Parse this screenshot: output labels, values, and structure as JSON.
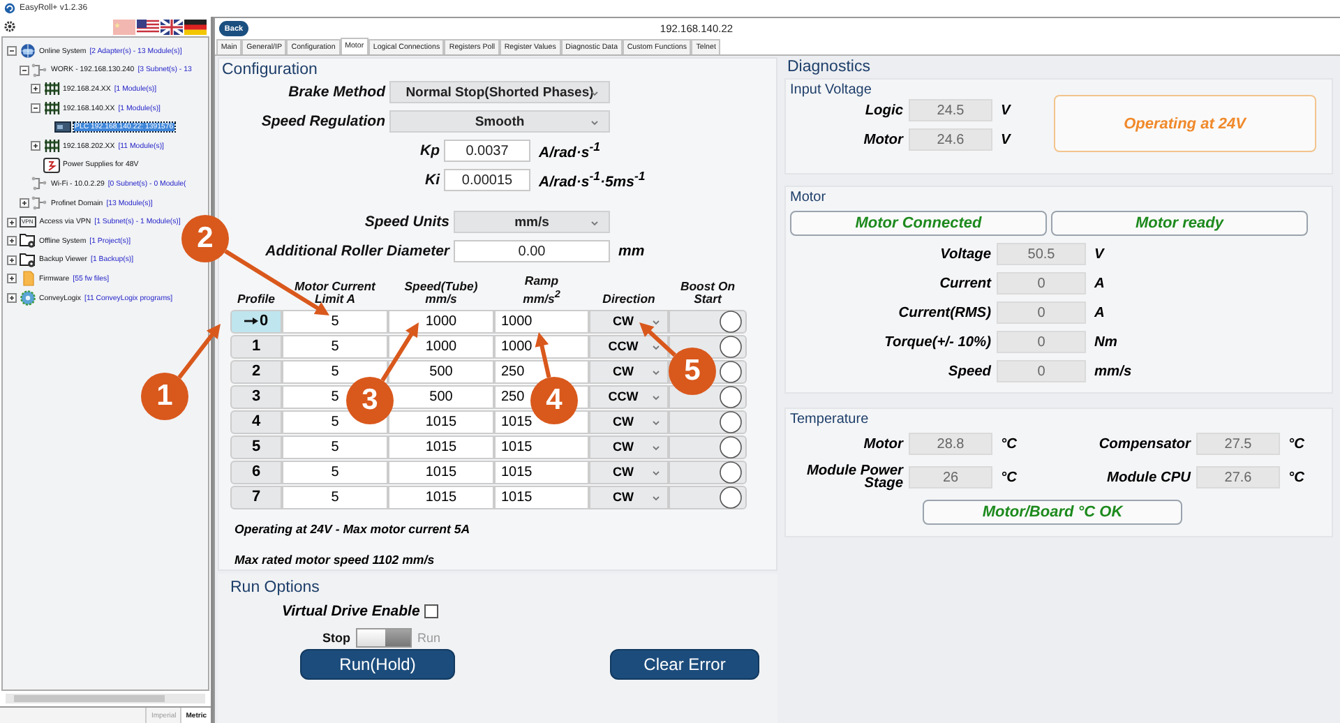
{
  "window": {
    "title": "EasyRoll+ v1.2.36"
  },
  "sidebar": {
    "tree": [
      {
        "kind": "globe",
        "label": "Online System",
        "detail": "[2 Adapter(s) - 13 Module(s)]",
        "expanded": true,
        "selected": false,
        "children": [
          {
            "kind": "network",
            "label": "WORK - 192.168.130.240",
            "detail": "[3 Subnet(s) - 13",
            "expanded": true,
            "selected": false,
            "children": [
              {
                "kind": "switch",
                "label": "192.168.24.XX",
                "detail": "[1 Module(s)]",
                "expanded": false,
                "selected": false
              },
              {
                "kind": "switch",
                "label": "192.168.140.XX",
                "detail": "[1 Module(s)]",
                "expanded": true,
                "selected": false,
                "children": [
                  {
                    "kind": "plc",
                    "label": "PLC 192.168.140.22: 1391576",
                    "selected": true
                  }
                ]
              },
              {
                "kind": "switch",
                "label": "192.168.202.XX",
                "detail": "[11 Module(s)]",
                "expanded": false,
                "selected": false
              },
              {
                "kind": "power",
                "label": "Power Supplies for 48V",
                "selected": false
              }
            ]
          },
          {
            "kind": "network",
            "label": "Wi-Fi - 10.0.2.29",
            "detail": "[0 Subnet(s) - 0 Module(",
            "selected": false
          },
          {
            "kind": "network",
            "label": "Profinet Domain",
            "detail": "[13 Module(s)]",
            "expanded": false,
            "selected": false
          }
        ]
      },
      {
        "kind": "vpn",
        "icon_label": "VPN",
        "label": "Access via VPN",
        "detail": "[1 Subnet(s) - 1 Module(s)]",
        "expanded": false,
        "selected": false
      },
      {
        "kind": "folder",
        "label": "Offline System",
        "detail": "[1 Project(s)]",
        "expanded": false,
        "selected": false
      },
      {
        "kind": "folder",
        "label": "Backup Viewer",
        "detail": "[1 Backup(s)]",
        "expanded": false,
        "selected": false
      },
      {
        "kind": "firmware",
        "label": "Firmware",
        "detail": "[55 fw files]",
        "expanded": false,
        "selected": false
      },
      {
        "kind": "logix",
        "label": "ConveyLogix",
        "detail": "[11 ConveyLogix programs]",
        "expanded": false,
        "selected": false
      }
    ],
    "unit_tabs": [
      {
        "label": "Imperial",
        "selected": false
      },
      {
        "label": "Metric",
        "selected": true
      }
    ]
  },
  "header": {
    "back_button": "Back",
    "title": "192.168.140.22"
  },
  "tabs": [
    {
      "label": "Main",
      "selected": false
    },
    {
      "label": "General/IP",
      "selected": false
    },
    {
      "label": "Configuration",
      "selected": false
    },
    {
      "label": "Motor",
      "selected": true
    },
    {
      "label": "Logical Connections",
      "selected": false
    },
    {
      "label": "Registers Poll",
      "selected": false
    },
    {
      "label": "Register Values",
      "selected": false
    },
    {
      "label": "Diagnostic Data",
      "selected": false
    },
    {
      "label": "Custom Functions",
      "selected": false
    },
    {
      "label": "Telnet",
      "selected": false
    }
  ],
  "configuration": {
    "title": "Configuration",
    "settings": [
      {
        "kind": "dropdown",
        "label": "Brake Method",
        "value": "Normal Stop(Shorted Phases)"
      },
      {
        "kind": "dropdown",
        "label": "Speed Regulation",
        "value": "Smooth"
      },
      {
        "kind": "input",
        "label": "Kp",
        "value": "0.0037",
        "unit": "A/rad·s$^{-1}$"
      },
      {
        "kind": "input",
        "label": "Ki",
        "value": "0.00015",
        "unit": "A/rad·s$^{-1}$·5ms$^{-1}$"
      }
    ],
    "units": [
      {
        "kind": "dropdown",
        "label": "Speed Units",
        "value": "mm/s"
      },
      {
        "kind": "input",
        "label": "Additional Roller Diameter",
        "value": "0.00",
        "unit": "mm"
      }
    ],
    "profiles": {
      "columns": [
        "Profile",
        "Motor Current Limit A",
        "Speed(Tube) mm/s",
        "Ramp mm/s$^{2}$",
        "Direction",
        "Boost On Start"
      ],
      "rows": [
        {
          "profile": "0",
          "current": "5",
          "speed": "1000",
          "ramp": "1000",
          "direction": "CW",
          "boost": false,
          "selected": true
        },
        {
          "profile": "1",
          "current": "5",
          "speed": "1000",
          "ramp": "1000",
          "direction": "CCW",
          "boost": false,
          "selected": false
        },
        {
          "profile": "2",
          "current": "5",
          "speed": "500",
          "ramp": "250",
          "direction": "CW",
          "boost": false,
          "selected": false
        },
        {
          "profile": "3",
          "current": "5",
          "speed": "500",
          "ramp": "250",
          "direction": "CCW",
          "boost": false,
          "selected": false
        },
        {
          "profile": "4",
          "current": "5",
          "speed": "1015",
          "ramp": "1015",
          "direction": "CW",
          "boost": false,
          "selected": false
        },
        {
          "profile": "5",
          "current": "5",
          "speed": "1015",
          "ramp": "1015",
          "direction": "CW",
          "boost": false,
          "selected": false
        },
        {
          "profile": "6",
          "current": "5",
          "speed": "1015",
          "ramp": "1015",
          "direction": "CW",
          "boost": false,
          "selected": false
        },
        {
          "profile": "7",
          "current": "5",
          "speed": "1015",
          "ramp": "1015",
          "direction": "CW",
          "boost": false,
          "selected": false
        }
      ]
    },
    "notes": [
      "Operating at 24V - Max motor current 5A",
      "Max rated motor speed 1102 mm/s"
    ]
  },
  "run_options": {
    "title": "Run Options",
    "virtual_drive": {
      "label": "Virtual Drive Enable",
      "checked": false
    },
    "run_switch": {
      "off_label": "Stop",
      "on_label": "Run",
      "on": false
    },
    "buttons": [
      "Run(Hold)",
      "Clear Error"
    ]
  },
  "diagnostics": {
    "title": "Diagnostics",
    "input_voltage": {
      "title": "Input Voltage",
      "readings": [
        {
          "label": "Logic",
          "value": "24.5",
          "unit": "V"
        },
        {
          "label": "Motor",
          "value": "24.6",
          "unit": "V"
        }
      ],
      "status": {
        "text": "Operating at 24V",
        "kind": "warning"
      }
    },
    "motor": {
      "title": "Motor",
      "statuses": [
        {
          "text": "Motor Connected",
          "kind": "ok"
        },
        {
          "text": "Motor ready",
          "kind": "ok"
        }
      ],
      "readings": [
        {
          "label": "Voltage",
          "value": "50.5",
          "unit": "V"
        },
        {
          "label": "Current",
          "value": "0",
          "unit": "A"
        },
        {
          "label": "Current(RMS)",
          "value": "0",
          "unit": "A"
        },
        {
          "label": "Torque(+/- 10%)",
          "value": "0",
          "unit": "Nm"
        },
        {
          "label": "Speed",
          "value": "0",
          "unit": "mm/s"
        }
      ]
    },
    "temperature": {
      "title": "Temperature",
      "readings": [
        {
          "label": "Motor",
          "value": "28.8",
          "unit": "°C"
        },
        {
          "label": "Compensator",
          "value": "27.5",
          "unit": "°C"
        },
        {
          "label": "Module Power Stage",
          "value": "26",
          "unit": "°C"
        },
        {
          "label": "Module CPU",
          "value": "27.6",
          "unit": "°C"
        }
      ],
      "status": {
        "text": "Motor/Board °C OK",
        "kind": "ok"
      }
    }
  },
  "callouts": [
    {
      "number": "1"
    },
    {
      "number": "2"
    },
    {
      "number": "3"
    },
    {
      "number": "4"
    },
    {
      "number": "5"
    }
  ]
}
